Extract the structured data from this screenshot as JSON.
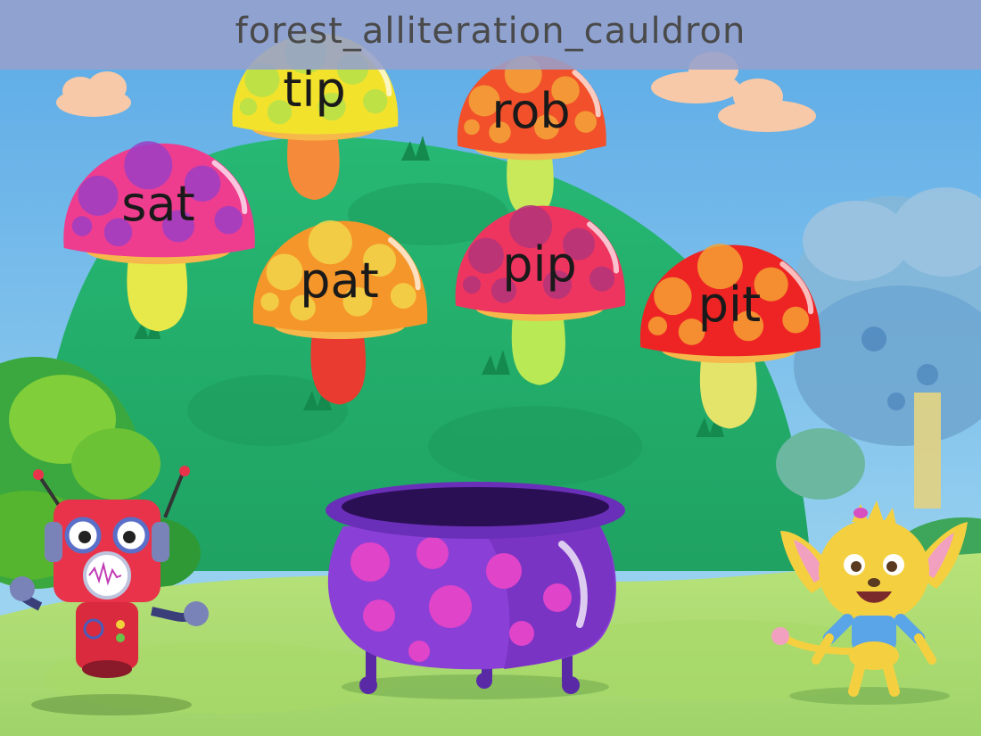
{
  "game": {
    "title": "forest_alliteration_cauldron"
  },
  "mushrooms": [
    {
      "id": "tip",
      "word": "tip",
      "cap_color": "#f2e22c",
      "spot_color": "#b5e04a",
      "stem_color": "#f58a3a"
    },
    {
      "id": "rob",
      "word": "rob",
      "cap_color": "#f2502a",
      "spot_color": "#f4a53a",
      "stem_color": "#c9e85a"
    },
    {
      "id": "sat",
      "word": "sat",
      "cap_color": "#ee3d8f",
      "spot_color": "#9b3ec4",
      "stem_color": "#e7e84a"
    },
    {
      "id": "pat",
      "word": "pat",
      "cap_color": "#f5962a",
      "spot_color": "#f2d64a",
      "stem_color": "#e93b2f"
    },
    {
      "id": "pip",
      "word": "pip",
      "cap_color": "#ee3560",
      "spot_color": "#b0347a",
      "stem_color": "#b9ea55"
    },
    {
      "id": "pit",
      "word": "pit",
      "cap_color": "#ee2424",
      "spot_color": "#f5a133",
      "stem_color": "#e4e36a"
    }
  ],
  "cauldron": {
    "body_color": "#8a3fd6",
    "spot_color": "#e044c8",
    "rim_color": "#6a2fb8"
  },
  "characters": [
    {
      "id": "robot",
      "icon": "robot-character-icon"
    },
    {
      "id": "creature",
      "icon": "yellow-creature-character-icon"
    }
  ]
}
